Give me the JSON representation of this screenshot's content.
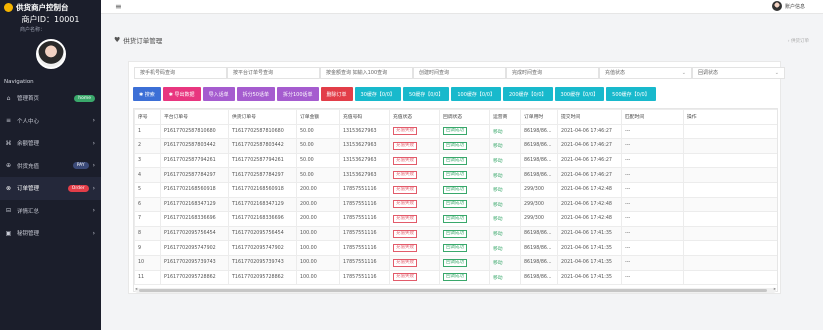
{
  "sidebar": {
    "brand": "供货商户控制台",
    "shop_id": "商户ID：10001",
    "shop_name_label": "商户名称：",
    "nav_heading": "Navigation",
    "items": [
      {
        "icon": "⌂",
        "label": "管理首页",
        "badge": "home",
        "badge_color": "#3aa86b"
      },
      {
        "icon": "≡",
        "label": "个人中心",
        "chevron": "›"
      },
      {
        "icon": "⌘",
        "label": "余额管理",
        "chevron": "›"
      },
      {
        "icon": "⊕",
        "label": "供货充值",
        "badge": "PAY",
        "badge_color": "#3b4a78",
        "chevron": "›"
      },
      {
        "icon": "⊗",
        "label": "订单管理",
        "badge": "Order",
        "badge_color": "#e23d48",
        "chevron": "›"
      },
      {
        "icon": "⊟",
        "label": "详情汇总",
        "chevron": "›"
      },
      {
        "icon": "▣",
        "label": "秘钥管理",
        "chevron": "›"
      }
    ]
  },
  "topbar": {
    "menu_icon": "≡",
    "user_name": "账户信息"
  },
  "page": {
    "title": "供货订单管理",
    "breadcrumb": "供货订单"
  },
  "filters": [
    {
      "placeholder": "按手机号码查询"
    },
    {
      "placeholder": "按平台订单号查询"
    },
    {
      "placeholder": "按金额查询 如输入100查询"
    },
    {
      "placeholder": "创建时间查询"
    },
    {
      "placeholder": "完成时间查询"
    },
    {
      "placeholder": "充值状态",
      "dropdown": true
    },
    {
      "placeholder": "回调状态",
      "dropdown": true
    }
  ],
  "buttons": [
    {
      "label": "✱ 搜索",
      "color": "blue"
    },
    {
      "label": "✱ 导出数据",
      "color": "pink"
    },
    {
      "label": "导入话单",
      "color": "purple"
    },
    {
      "label": "拆分50话单",
      "color": "purple"
    },
    {
      "label": "拆分100话单",
      "color": "purple"
    },
    {
      "label": "删除订单",
      "color": "red"
    },
    {
      "label": "30缓存【0/0】",
      "color": "cyan"
    },
    {
      "label": "50缓存【0/0】",
      "color": "cyan"
    },
    {
      "label": "100缓存【0/0】",
      "color": "cyan"
    },
    {
      "label": "200缓存【0/0】",
      "color": "cyan"
    },
    {
      "label": "300缓存【0/0】",
      "color": "cyan"
    },
    {
      "label": "500缓存【0/0】",
      "color": "cyan"
    }
  ],
  "table": {
    "headers": [
      "序号",
      "平台订单号",
      "供货订单号",
      "订单金额",
      "充值号码",
      "充值状态",
      "回调状态",
      "运营商",
      "订单用时",
      "提交时间",
      "匹配时间",
      "操作"
    ],
    "rows": [
      [
        "1",
        "P1617702587810680",
        "T1617702587810680",
        "50.00",
        "13153627963",
        "充值失败",
        "回调成功",
        "移动",
        "86198/86...",
        "2021-04-06 17:46:27",
        "---",
        ""
      ],
      [
        "2",
        "P1617702587803442",
        "T1617702587803442",
        "50.00",
        "13153627963",
        "充值失败",
        "回调成功",
        "移动",
        "86198/86...",
        "2021-04-06 17:46:27",
        "---",
        ""
      ],
      [
        "3",
        "P1617702587794261",
        "T1617702587794261",
        "50.00",
        "13153627963",
        "充值失败",
        "回调成功",
        "移动",
        "86198/86...",
        "2021-04-06 17:46:27",
        "---",
        ""
      ],
      [
        "4",
        "P1617702587784297",
        "T1617702587784297",
        "50.00",
        "13153627963",
        "充值失败",
        "回调成功",
        "移动",
        "86198/86...",
        "2021-04-06 17:46:27",
        "---",
        ""
      ],
      [
        "5",
        "P1617702168560918",
        "T1617702168560918",
        "200.00",
        "17857551116",
        "充值失败",
        "回调成功",
        "移动",
        "299/300",
        "2021-04-06 17:42:48",
        "---",
        ""
      ],
      [
        "6",
        "P1617702168347129",
        "T1617702168347129",
        "200.00",
        "17857551116",
        "充值失败",
        "回调成功",
        "移动",
        "299/300",
        "2021-04-06 17:42:48",
        "---",
        ""
      ],
      [
        "7",
        "P1617702168336696",
        "T1617702168336696",
        "200.00",
        "17857551116",
        "充值失败",
        "回调成功",
        "移动",
        "299/300",
        "2021-04-06 17:42:48",
        "---",
        ""
      ],
      [
        "8",
        "P1617702095756454",
        "T1617702095756454",
        "100.00",
        "17857551116",
        "充值失败",
        "回调成功",
        "移动",
        "86198/86...",
        "2021-04-06 17:41:35",
        "---",
        ""
      ],
      [
        "9",
        "P1617702095747902",
        "T1617702095747902",
        "100.00",
        "17857551116",
        "充值失败",
        "回调成功",
        "移动",
        "86198/86...",
        "2021-04-06 17:41:35",
        "---",
        ""
      ],
      [
        "10",
        "P1617702095739743",
        "T1617702095739743",
        "100.00",
        "17857551116",
        "充值失败",
        "回调成功",
        "移动",
        "86198/86...",
        "2021-04-06 17:41:35",
        "---",
        ""
      ],
      [
        "11",
        "P1617702095728862",
        "T1617702095728862",
        "100.00",
        "17857551116",
        "充值失败",
        "回调成功",
        "移动",
        "86198/86...",
        "2021-04-06 17:41:35",
        "---",
        ""
      ]
    ]
  },
  "colors": {
    "sidebar_bg": "#1b1e2b",
    "fail_tag": "#e25b6a",
    "success_tag": "#39a86b"
  }
}
